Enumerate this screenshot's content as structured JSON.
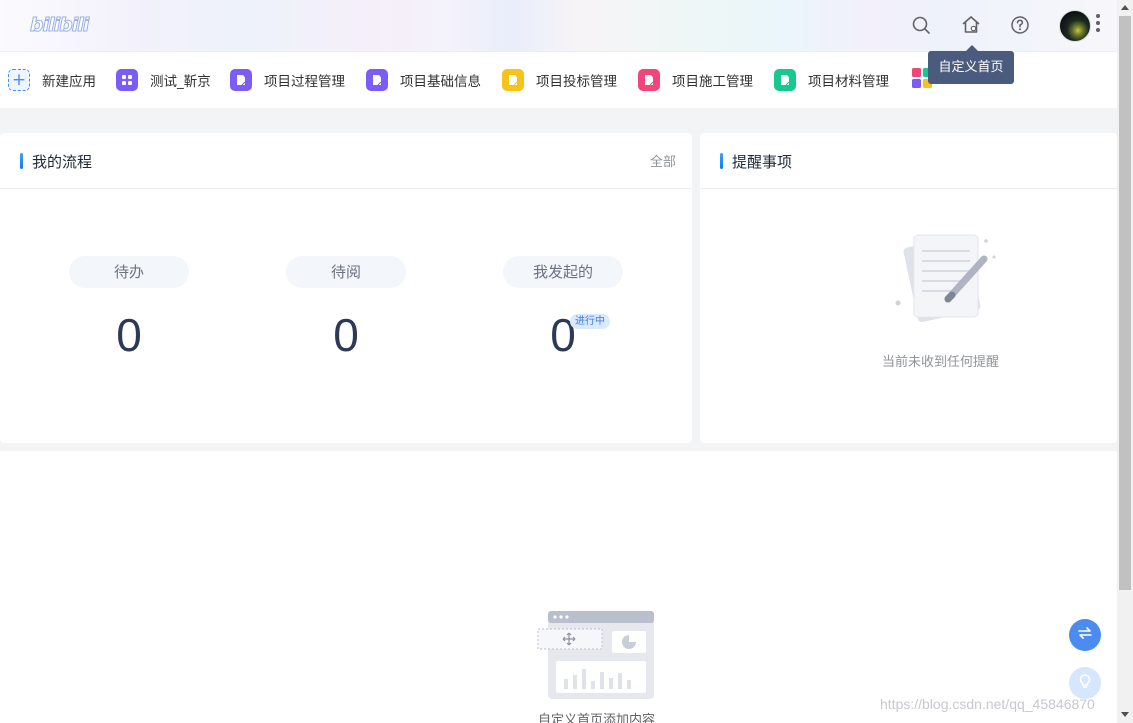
{
  "header": {
    "logo_text": "bilibili",
    "tooltip": "自定义首页",
    "icons": [
      "search-icon",
      "home-settings-icon",
      "help-icon"
    ]
  },
  "apps": [
    {
      "label": "新建应用",
      "icon": "plus-icon",
      "color": "#4a8cf0"
    },
    {
      "label": "测试_靳京",
      "icon": "grid-icon",
      "color": "#7b5cf5"
    },
    {
      "label": "项目过程管理",
      "icon": "document-icon",
      "color": "#7b5cf5"
    },
    {
      "label": "项目基础信息",
      "icon": "document-icon",
      "color": "#7b5cf5"
    },
    {
      "label": "项目投标管理",
      "icon": "document-icon",
      "color": "#f7c21a"
    },
    {
      "label": "项目施工管理",
      "icon": "document-icon",
      "color": "#f0467a"
    },
    {
      "label": "项目材料管理",
      "icon": "document-icon",
      "color": "#17c98e"
    }
  ],
  "flow": {
    "title": "我的流程",
    "all_link": "全部",
    "stats": [
      {
        "label": "待办",
        "value": "0"
      },
      {
        "label": "待阅",
        "value": "0"
      },
      {
        "label": "我发起的",
        "value": "0"
      }
    ],
    "badge": "进行中"
  },
  "reminders": {
    "title": "提醒事项",
    "empty_text": "当前未收到任何提醒"
  },
  "custom_area": {
    "empty_text": "自定义首页添加内容"
  },
  "watermark": "https://blog.csdn.net/qq_45846870",
  "colors": {
    "accent": "#1877f2",
    "tooltip_bg": "#4b5b7e",
    "number": "#2d3a56"
  }
}
